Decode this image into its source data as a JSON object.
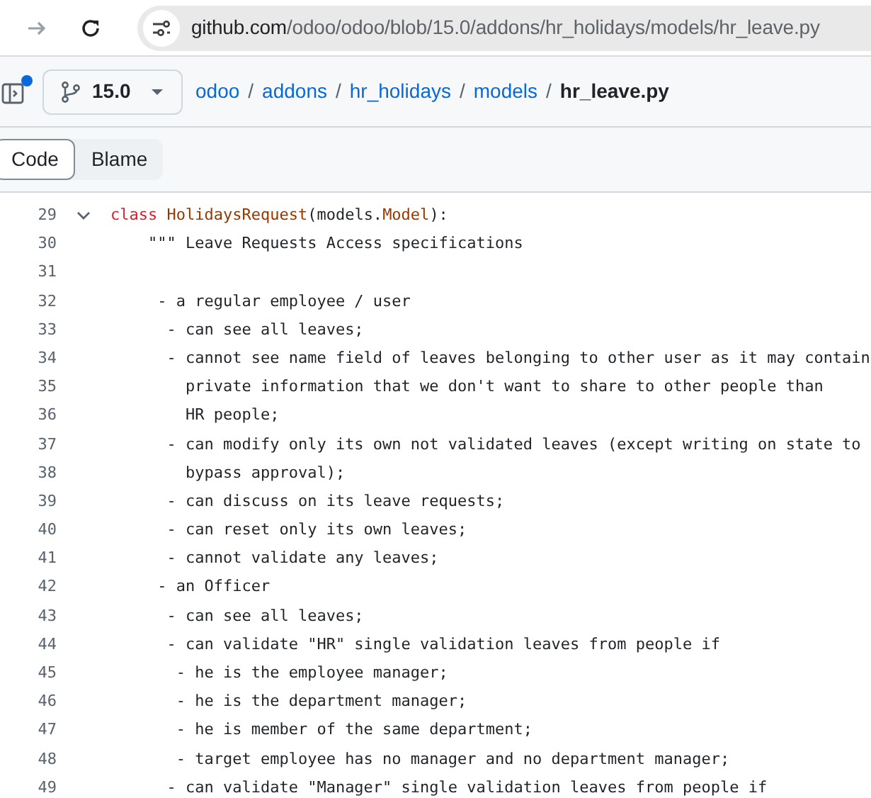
{
  "browser": {
    "url_host": "github.com",
    "url_path": "/odoo/odoo/blob/15.0/addons/hr_holidays/models/hr_leave.py"
  },
  "file_header": {
    "notification_dot": true,
    "branch": "15.0",
    "breadcrumb": [
      {
        "label": "odoo",
        "current": false
      },
      {
        "label": "addons",
        "current": false
      },
      {
        "label": "hr_holidays",
        "current": false
      },
      {
        "label": "models",
        "current": false
      },
      {
        "label": "hr_leave.py",
        "current": true
      }
    ],
    "separator": "/"
  },
  "view_tabs": [
    {
      "label": "Code",
      "selected": true
    },
    {
      "label": "Blame",
      "selected": false
    }
  ],
  "code_lines": [
    {
      "number": "29",
      "expanded": true,
      "segments": [
        {
          "text": "class",
          "kind": "keyword"
        },
        {
          "text": "HolidaysRequest",
          "kind": "title"
        },
        {
          "text": "(models.",
          "kind": "plain"
        },
        {
          "text": "Model",
          "kind": "title"
        },
        {
          "text": "):",
          "kind": "plain"
        }
      ]
    },
    {
      "number": "30",
      "segments": [
        {
          "text": "    \"\"\" Leave Requests Access specifications",
          "kind": "string"
        }
      ]
    },
    {
      "number": "31"
    },
    {
      "number": "32",
      "segments": [
        {
          "text": "     - a regular employee / user",
          "kind": "string"
        }
      ]
    },
    {
      "number": "33",
      "segments": [
        {
          "text": "      - can see all leaves;",
          "kind": "string"
        }
      ]
    },
    {
      "number": "34",
      "segments": [
        {
          "text": "      - cannot see name field of leaves belonging to other user as it may contain",
          "kind": "string"
        }
      ]
    },
    {
      "number": "35",
      "segments": [
        {
          "text": "        private information that we don't want to share to other people than",
          "kind": "string"
        }
      ]
    },
    {
      "number": "36",
      "segments": [
        {
          "text": "        HR people;",
          "kind": "string"
        }
      ]
    },
    {
      "number": "37",
      "segments": [
        {
          "text": "      - can modify only its own not validated leaves (except writing on state to",
          "kind": "string"
        }
      ]
    },
    {
      "number": "38",
      "segments": [
        {
          "text": "        bypass approval);",
          "kind": "string"
        }
      ]
    },
    {
      "number": "39",
      "segments": [
        {
          "text": "      - can discuss on its leave requests;",
          "kind": "string"
        }
      ]
    },
    {
      "number": "40",
      "segments": [
        {
          "text": "      - can reset only its own leaves;",
          "kind": "string"
        }
      ]
    },
    {
      "number": "41",
      "segments": [
        {
          "text": "      - cannot validate any leaves;",
          "kind": "string"
        }
      ]
    },
    {
      "number": "42",
      "segments": [
        {
          "text": "     - an Officer",
          "kind": "string"
        }
      ]
    },
    {
      "number": "43",
      "segments": [
        {
          "text": "      - can see all leaves;",
          "kind": "string"
        }
      ]
    },
    {
      "number": "44",
      "segments": [
        {
          "text": "      - can validate \"HR\" single validation leaves from people if",
          "kind": "string"
        }
      ]
    },
    {
      "number": "45",
      "segments": [
        {
          "text": "       - he is the employee manager;",
          "kind": "string"
        }
      ]
    },
    {
      "number": "46",
      "segments": [
        {
          "text": "       - he is the department manager;",
          "kind": "string"
        }
      ]
    },
    {
      "number": "47",
      "segments": [
        {
          "text": "       - he is member of the same department;",
          "kind": "string"
        }
      ]
    },
    {
      "number": "48",
      "segments": [
        {
          "text": "       - target employee has no manager and no department manager;",
          "kind": "string"
        }
      ]
    },
    {
      "number": "49",
      "segments": [
        {
          "text": "      - can validate \"Manager\" single validation leaves from people if",
          "kind": "string"
        }
      ]
    }
  ]
}
